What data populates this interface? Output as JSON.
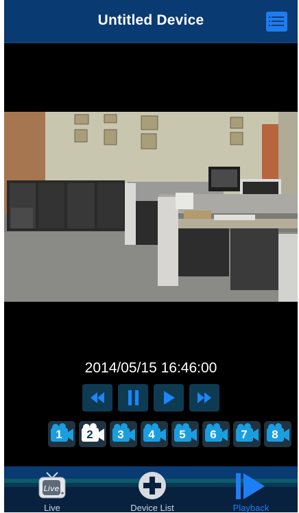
{
  "header": {
    "title": "Untitled Device",
    "menu_icon": "list-menu-icon"
  },
  "video": {
    "scene": "office-camera-feed"
  },
  "playback": {
    "timestamp": "2014/05/15 16:46:00",
    "buttons": [
      "rewind-icon",
      "pause-icon",
      "play-icon",
      "fast-forward-icon"
    ]
  },
  "cameras": [
    {
      "label": "1",
      "active": false
    },
    {
      "label": "2",
      "active": true
    },
    {
      "label": "3",
      "active": false
    },
    {
      "label": "4",
      "active": false
    },
    {
      "label": "5",
      "active": false
    },
    {
      "label": "6",
      "active": false
    },
    {
      "label": "7",
      "active": false
    },
    {
      "label": "8",
      "active": false
    }
  ],
  "tabs": [
    {
      "label": "Live",
      "icon": "tv-icon",
      "icon_text": "Live",
      "active": false
    },
    {
      "label": "Device List",
      "icon": "plus-circle-icon",
      "active": false
    },
    {
      "label": "Playback",
      "icon": "playback-icon",
      "active": true
    }
  ],
  "colors": {
    "header_bg": "#0a3a72",
    "accent_blue": "#1e7ff5",
    "button_bg": "#0e3b52",
    "button_glyph": "#1a86ff"
  }
}
